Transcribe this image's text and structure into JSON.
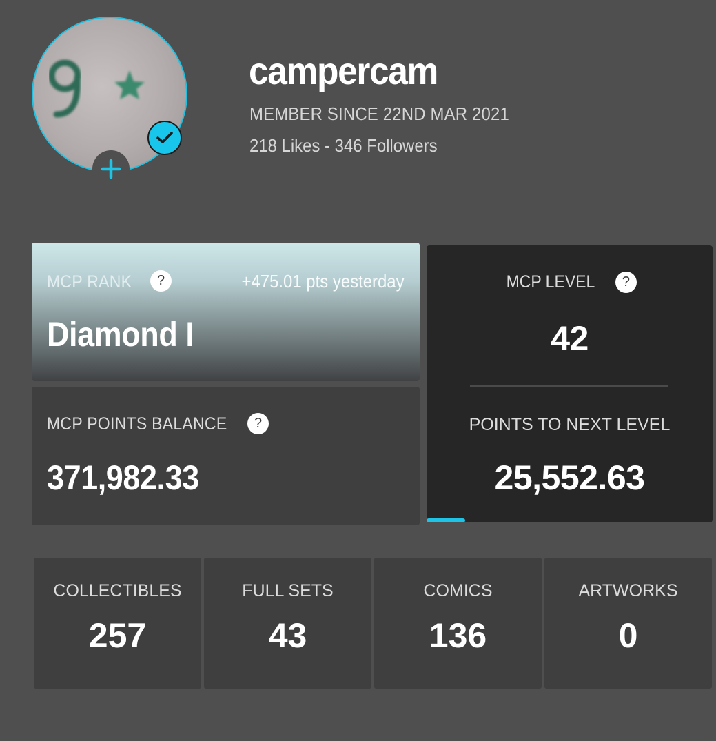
{
  "profile": {
    "username": "campercam",
    "member_since": "MEMBER SINCE 22ND MAR 2021",
    "likes_followers": "218 Likes - 346 Followers",
    "avatar_icon": "avatar-image",
    "verified_icon": "checkmark-icon",
    "add_icon": "plus-icon"
  },
  "rank": {
    "label": "MCP RANK",
    "change": "+475.01 pts yesterday",
    "value": "Diamond I"
  },
  "balance": {
    "label": "MCP POINTS BALANCE",
    "value": "371,982.33"
  },
  "level": {
    "label": "MCP LEVEL",
    "value": "42",
    "next_label": "POINTS TO NEXT LEVEL",
    "next_value": "25,552.63",
    "progress_fraction": 0.135
  },
  "stats": [
    {
      "label": "COLLECTIBLES",
      "value": "257"
    },
    {
      "label": "FULL SETS",
      "value": "43"
    },
    {
      "label": "COMICS",
      "value": "136"
    },
    {
      "label": "ARTWORKS",
      "value": "0"
    }
  ],
  "colors": {
    "accent": "#1ec3e6",
    "background": "#4f4f4f",
    "card": "#3f3f3f",
    "level_card": "#262626"
  }
}
